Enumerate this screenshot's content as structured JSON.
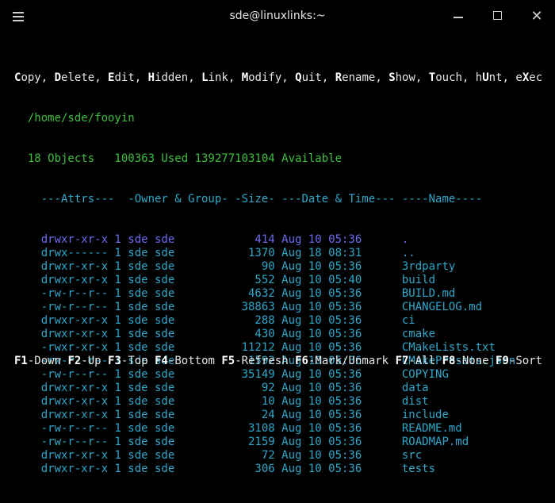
{
  "window": {
    "title": "sde@linuxlinks:~"
  },
  "menu": {
    "items": [
      {
        "key": "C",
        "rest": "opy"
      },
      {
        "key": "D",
        "rest": "elete"
      },
      {
        "key": "E",
        "rest": "dit"
      },
      {
        "key": "H",
        "rest": "idden"
      },
      {
        "key": "L",
        "rest": "ink"
      },
      {
        "key": "M",
        "rest": "odify"
      },
      {
        "key": "Q",
        "rest": "uit"
      },
      {
        "key": "R",
        "rest": "ename"
      },
      {
        "key": "S",
        "rest": "how"
      },
      {
        "key": "T",
        "rest": "ouch"
      },
      {
        "pre": "h",
        "key": "U",
        "rest": "nt"
      },
      {
        "pre": "e",
        "key": "X",
        "rest": "ec"
      }
    ]
  },
  "path": "/home/sde/fooyin",
  "summary": "18 Objects   100363 Used 139277103104 Available",
  "columns": "---Attrs---  -Owner & Group- -Size- ---Date & Time--- ----Name----",
  "files": [
    {
      "attrs": "drwxr-xr-x",
      "links": "1",
      "owner": "sde",
      "group": "sde",
      "size": "414",
      "date": "Aug 10 05:36",
      "name": "."
    },
    {
      "attrs": "drwx------",
      "links": "1",
      "owner": "sde",
      "group": "sde",
      "size": "1370",
      "date": "Aug 18 08:31",
      "name": ".."
    },
    {
      "attrs": "drwxr-xr-x",
      "links": "1",
      "owner": "sde",
      "group": "sde",
      "size": "90",
      "date": "Aug 10 05:36",
      "name": "3rdparty"
    },
    {
      "attrs": "drwxr-xr-x",
      "links": "1",
      "owner": "sde",
      "group": "sde",
      "size": "552",
      "date": "Aug 10 05:40",
      "name": "build"
    },
    {
      "attrs": "-rw-r--r--",
      "links": "1",
      "owner": "sde",
      "group": "sde",
      "size": "4632",
      "date": "Aug 10 05:36",
      "name": "BUILD.md"
    },
    {
      "attrs": "-rw-r--r--",
      "links": "1",
      "owner": "sde",
      "group": "sde",
      "size": "38863",
      "date": "Aug 10 05:36",
      "name": "CHANGELOG.md"
    },
    {
      "attrs": "drwxr-xr-x",
      "links": "1",
      "owner": "sde",
      "group": "sde",
      "size": "288",
      "date": "Aug 10 05:36",
      "name": "ci"
    },
    {
      "attrs": "drwxr-xr-x",
      "links": "1",
      "owner": "sde",
      "group": "sde",
      "size": "430",
      "date": "Aug 10 05:36",
      "name": "cmake"
    },
    {
      "attrs": "-rwxr-xr-x",
      "links": "1",
      "owner": "sde",
      "group": "sde",
      "size": "11212",
      "date": "Aug 10 05:36",
      "name": "CMakeLists.txt"
    },
    {
      "attrs": "-rw-r--r--",
      "links": "1",
      "owner": "sde",
      "group": "sde",
      "size": "1592",
      "date": "Aug 10 05:36",
      "name": "CMakePresets.json"
    },
    {
      "attrs": "-rw-r--r--",
      "links": "1",
      "owner": "sde",
      "group": "sde",
      "size": "35149",
      "date": "Aug 10 05:36",
      "name": "COPYING"
    },
    {
      "attrs": "drwxr-xr-x",
      "links": "1",
      "owner": "sde",
      "group": "sde",
      "size": "92",
      "date": "Aug 10 05:36",
      "name": "data"
    },
    {
      "attrs": "drwxr-xr-x",
      "links": "1",
      "owner": "sde",
      "group": "sde",
      "size": "10",
      "date": "Aug 10 05:36",
      "name": "dist"
    },
    {
      "attrs": "drwxr-xr-x",
      "links": "1",
      "owner": "sde",
      "group": "sde",
      "size": "24",
      "date": "Aug 10 05:36",
      "name": "include"
    },
    {
      "attrs": "-rw-r--r--",
      "links": "1",
      "owner": "sde",
      "group": "sde",
      "size": "3108",
      "date": "Aug 10 05:36",
      "name": "README.md"
    },
    {
      "attrs": "-rw-r--r--",
      "links": "1",
      "owner": "sde",
      "group": "sde",
      "size": "2159",
      "date": "Aug 10 05:36",
      "name": "ROADMAP.md"
    },
    {
      "attrs": "drwxr-xr-x",
      "links": "1",
      "owner": "sde",
      "group": "sde",
      "size": "72",
      "date": "Aug 10 05:36",
      "name": "src"
    },
    {
      "attrs": "drwxr-xr-x",
      "links": "1",
      "owner": "sde",
      "group": "sde",
      "size": "306",
      "date": "Aug 10 05:36",
      "name": "tests"
    }
  ],
  "fkeys": [
    {
      "key": "F1",
      "label": "-Down"
    },
    {
      "key": "F2",
      "label": "-Up"
    },
    {
      "key": "F3",
      "label": "-Top"
    },
    {
      "key": "F4",
      "label": "-Bottom"
    },
    {
      "key": "F5",
      "label": "-Refresh"
    },
    {
      "key": "F6",
      "label": "-Mark/Unmark"
    },
    {
      "key": "F7",
      "label": "-All"
    },
    {
      "key": "F8",
      "label": "-None"
    },
    {
      "key": "F9",
      "label": "-Sort"
    }
  ],
  "icons": {
    "hamburger": "hamburger-menu-icon",
    "minimize": "minimize-icon",
    "maximize": "maximize-icon",
    "close": "close-icon"
  }
}
